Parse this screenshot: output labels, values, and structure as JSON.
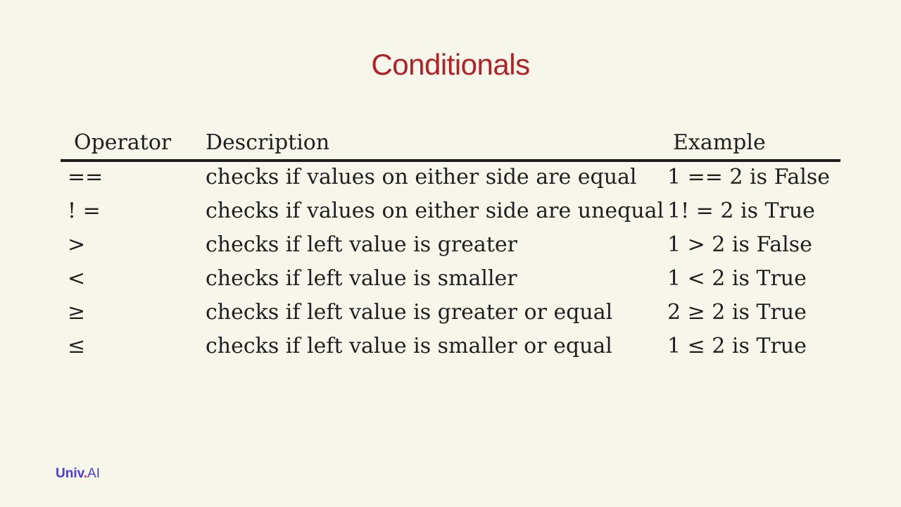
{
  "slide": {
    "title": "Conditionals"
  },
  "table": {
    "headers": {
      "operator": "Operator",
      "description": "Description",
      "example": "Example"
    },
    "rows": [
      {
        "operator": "==",
        "description": "checks if values on either side are equal",
        "example": "1 == 2 is False"
      },
      {
        "operator": "! =",
        "description": "checks if values on either side are unequal",
        "example": "1! = 2 is True"
      },
      {
        "operator": ">",
        "description": "checks if left value is greater",
        "example": "1 > 2 is False"
      },
      {
        "operator": "<",
        "description": "checks if left value is smaller",
        "example": "1 < 2 is True"
      },
      {
        "operator": "≥",
        "description": "checks if left value is greater or equal",
        "example": "2 ≥ 2 is True"
      },
      {
        "operator": "≤",
        "description": "checks if left value is smaller or equal",
        "example": "1 ≤ 2 is True"
      }
    ]
  },
  "logo": {
    "brand": "Univ",
    "dot": ".",
    "suffix": "AI"
  },
  "colors": {
    "background": "#f6f6ea",
    "title": "#b32025",
    "text": "#1f1f1f",
    "logo": "#4a3cd9"
  }
}
